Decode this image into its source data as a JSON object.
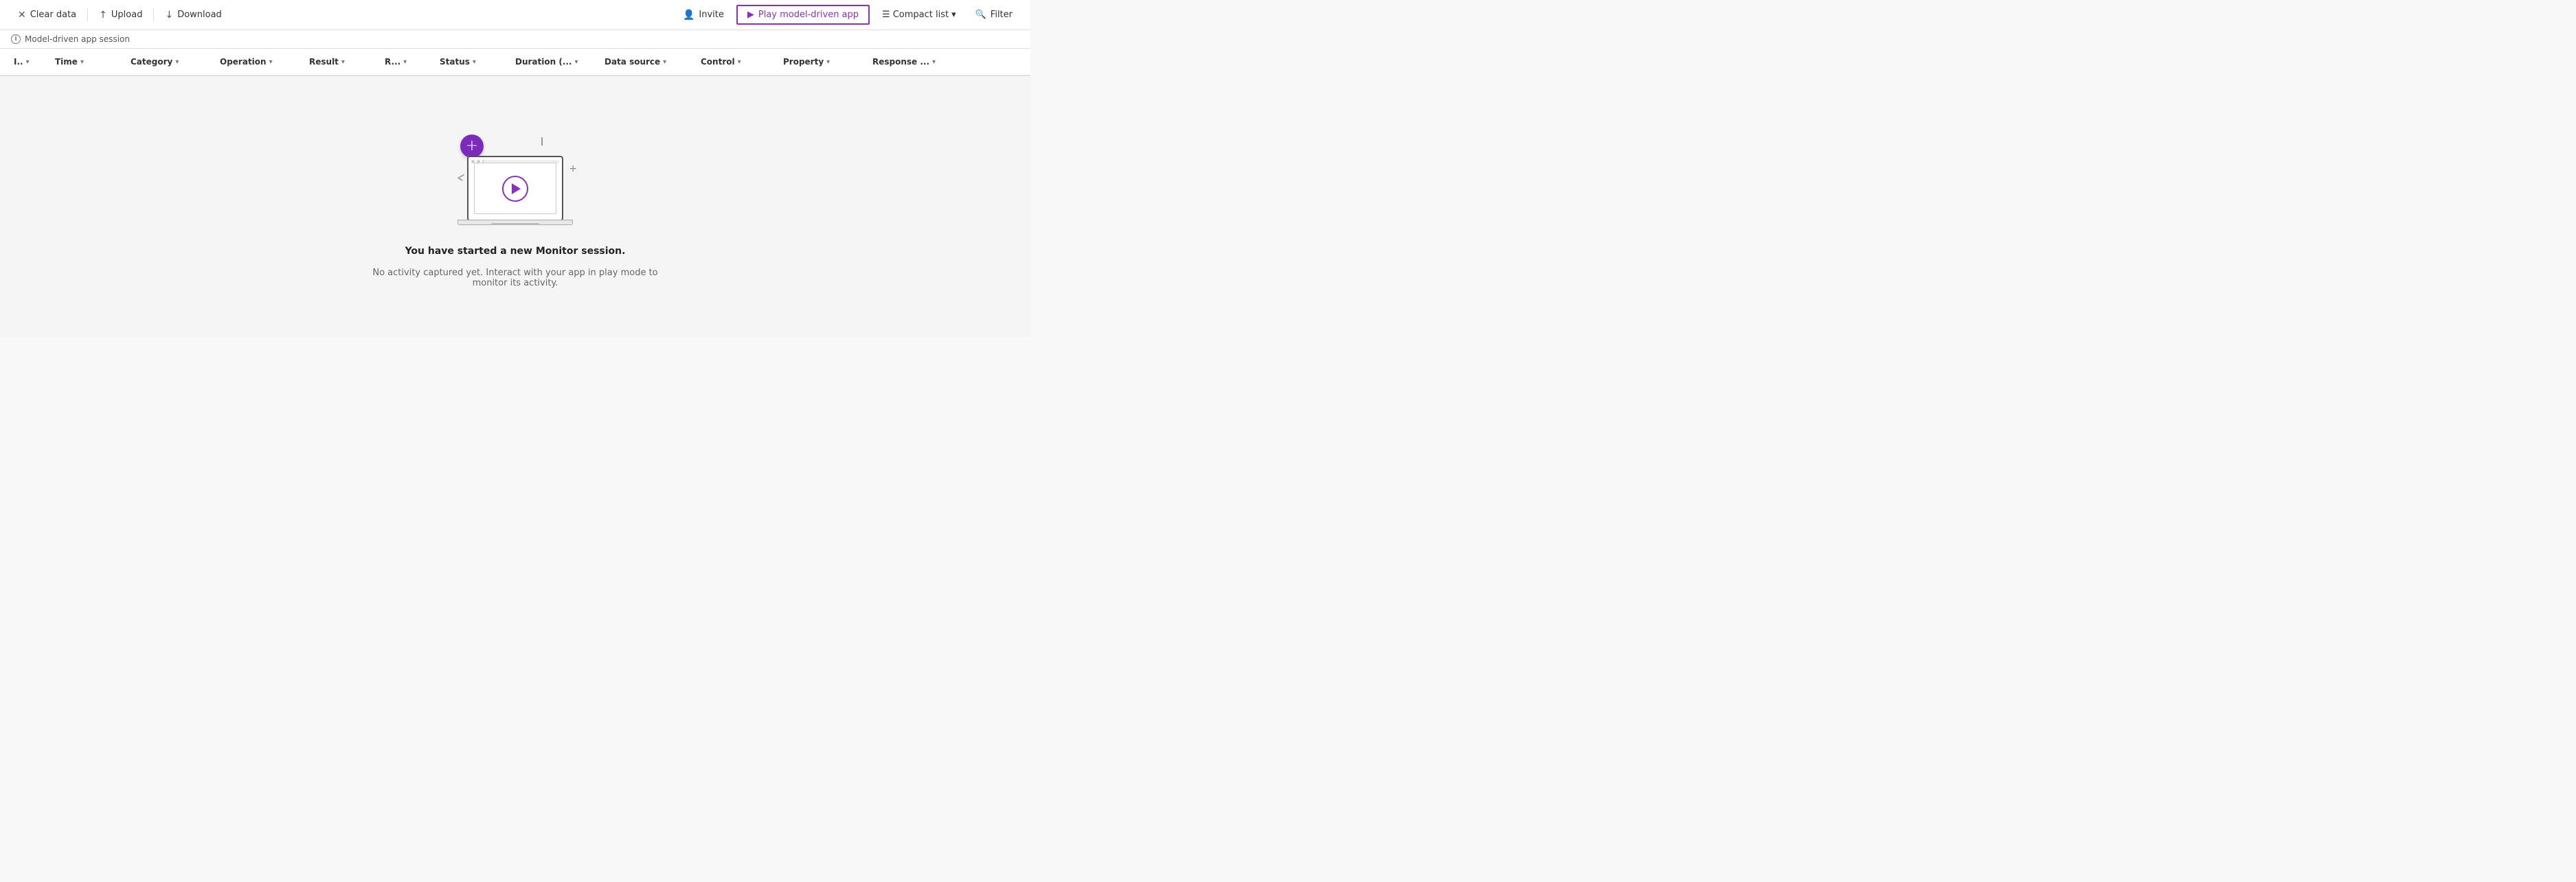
{
  "toolbar": {
    "clear_data_label": "Clear data",
    "upload_label": "Upload",
    "download_label": "Download",
    "invite_label": "Invite",
    "play_label": "Play model-driven app",
    "compact_list_label": "Compact list",
    "filter_label": "Filter"
  },
  "info_bar": {
    "session_label": "Model-driven app session"
  },
  "columns": {
    "id": "I..",
    "time": "Time",
    "category": "Category",
    "operation": "Operation",
    "result": "Result",
    "r": "R...",
    "status": "Status",
    "duration": "Duration (...",
    "data_source": "Data source",
    "control": "Control",
    "property": "Property",
    "response": "Response ..."
  },
  "empty_state": {
    "title": "You have started a new Monitor session.",
    "subtitle": "No activity captured yet. Interact with your app in play mode to monitor its activity."
  }
}
